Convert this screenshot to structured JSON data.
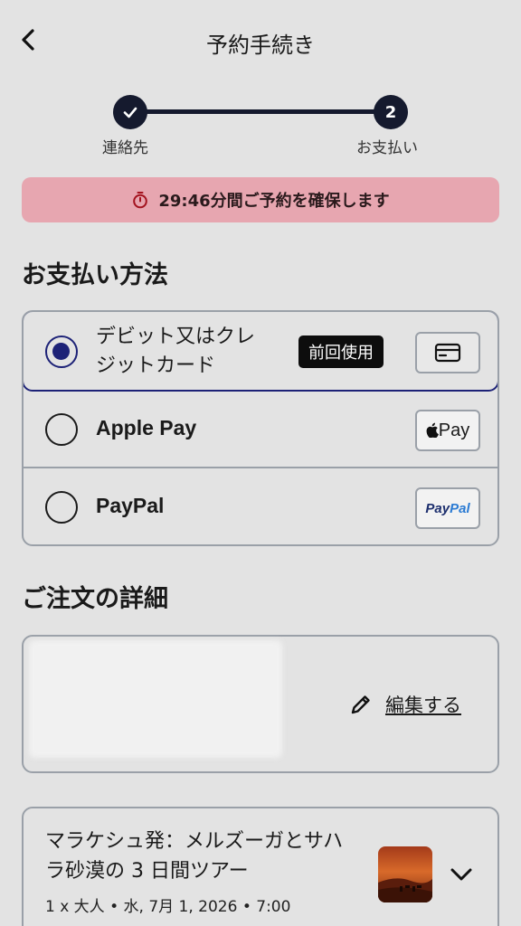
{
  "header": {
    "title": "予約手続き",
    "back_icon": "chevron-left-icon"
  },
  "stepper": {
    "steps": [
      {
        "label": "連絡先",
        "state": "completed",
        "icon": "check-icon"
      },
      {
        "label": "お支払い",
        "state": "current",
        "number": "2"
      }
    ]
  },
  "timer": {
    "time": "29:46",
    "text": "分間ご予約を確保します",
    "icon": "stopwatch-icon",
    "bg_color": "#e7a6b0"
  },
  "payment": {
    "section_title": "お支払い方法",
    "options": [
      {
        "label_line1": "デビット又はクレ",
        "label_line2": "ジットカード",
        "selected": true,
        "badge": "前回使用",
        "icon": "credit-card-icon"
      },
      {
        "label": "Apple Pay",
        "selected": false,
        "logo_text": "Pay",
        "icon": "apple-pay-logo"
      },
      {
        "label": "PayPal",
        "selected": false,
        "logo_pay": "Pay",
        "logo_pal": "Pal",
        "icon": "paypal-logo"
      }
    ],
    "accent_color": "#1d2277"
  },
  "order": {
    "section_title": "ご注文の詳細",
    "edit_label": "編集する",
    "edit_icon": "pencil-icon"
  },
  "tour": {
    "title": "マラケシュ発：メルズーガとサハラ砂漠の 3 日間ツアー",
    "meta": "1 x 大人 • 水, 7月 1, 2026 • 7:00",
    "expand_icon": "chevron-down-icon"
  }
}
